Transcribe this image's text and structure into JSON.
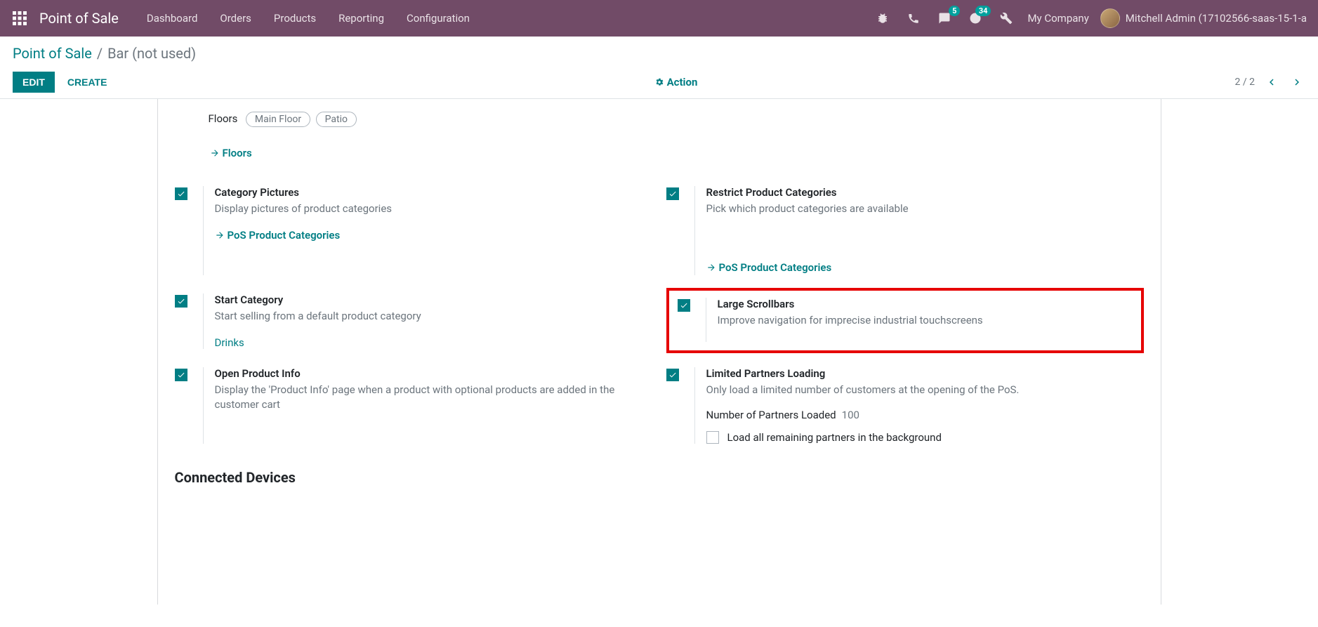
{
  "navbar": {
    "app_title": "Point of Sale",
    "menu": [
      "Dashboard",
      "Orders",
      "Products",
      "Reporting",
      "Configuration"
    ],
    "messages_badge": "5",
    "activities_badge": "34",
    "company": "My Company",
    "user": "Mitchell Admin (17102566-saas-15-1-a"
  },
  "breadcrumb": {
    "root": "Point of Sale",
    "current": "Bar (not used)"
  },
  "buttons": {
    "edit": "EDIT",
    "create": "CREATE",
    "action": "Action"
  },
  "pager": {
    "text": "2 / 2"
  },
  "floors": {
    "label": "Floors",
    "tags": [
      "Main Floor",
      "Patio"
    ],
    "link": "Floors"
  },
  "options": {
    "category_pictures": {
      "title": "Category Pictures",
      "desc": "Display pictures of product categories",
      "link": "PoS Product Categories"
    },
    "restrict_categories": {
      "title": "Restrict Product Categories",
      "desc": "Pick which product categories are available",
      "link": "PoS Product Categories"
    },
    "start_category": {
      "title": "Start Category",
      "desc": "Start selling from a default product category",
      "value": "Drinks"
    },
    "large_scrollbars": {
      "title": "Large Scrollbars",
      "desc": "Improve navigation for imprecise industrial touchscreens"
    },
    "open_product_info": {
      "title": "Open Product Info",
      "desc": "Display the 'Product Info' page when a product with optional products are added in the customer cart"
    },
    "limited_partners": {
      "title": "Limited Partners Loading",
      "desc": "Only load a limited number of customers at the opening of the PoS.",
      "field_label": "Number of Partners Loaded",
      "field_value": "100",
      "sub_check_label": "Load all remaining partners in the background"
    }
  },
  "section": {
    "connected_devices": "Connected Devices"
  }
}
